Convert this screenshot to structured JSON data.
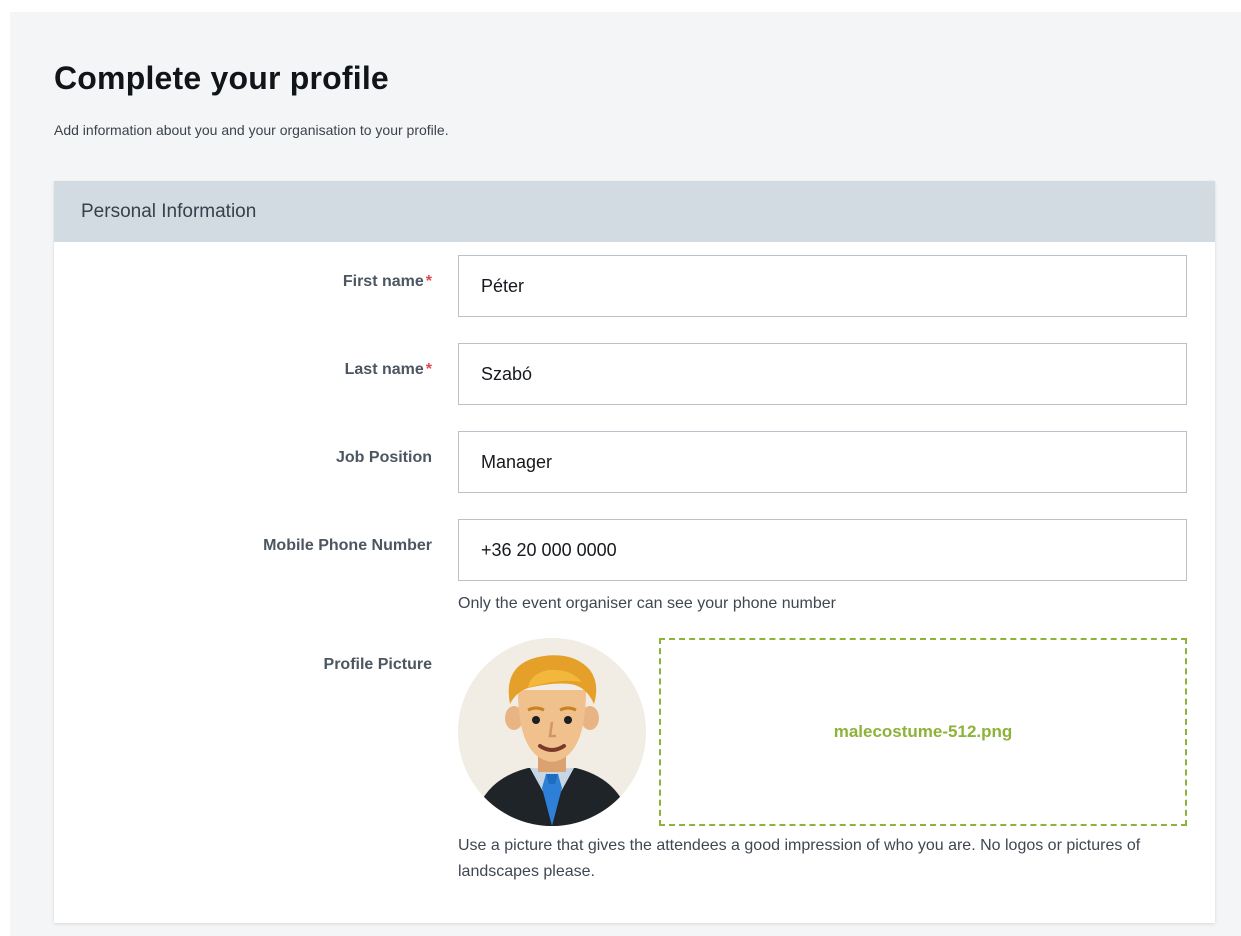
{
  "page": {
    "title": "Complete your profile",
    "subtitle": "Add information about you and your organisation to your profile."
  },
  "section": {
    "title": "Personal Information"
  },
  "form": {
    "first_name": {
      "label": "First name",
      "required_mark": "*",
      "value": "Péter"
    },
    "last_name": {
      "label": "Last name",
      "required_mark": "*",
      "value": "Szabó"
    },
    "job_position": {
      "label": "Job Position",
      "value": "Manager"
    },
    "mobile_phone": {
      "label": "Mobile Phone Number",
      "value": "+36 20 000 0000",
      "hint": "Only the event organiser can see your phone number"
    },
    "profile_picture": {
      "label": "Profile Picture",
      "filename": "malecostume-512.png",
      "hint": "Use a picture that gives the attendees a good impression of who you are. No logos or pictures of landscapes please."
    }
  },
  "colors": {
    "required": "#e0464e",
    "dropzone_accent": "#8db33a",
    "section_header_bg": "#d3dbe2"
  },
  "icons": {
    "avatar": "male-avatar-icon"
  }
}
